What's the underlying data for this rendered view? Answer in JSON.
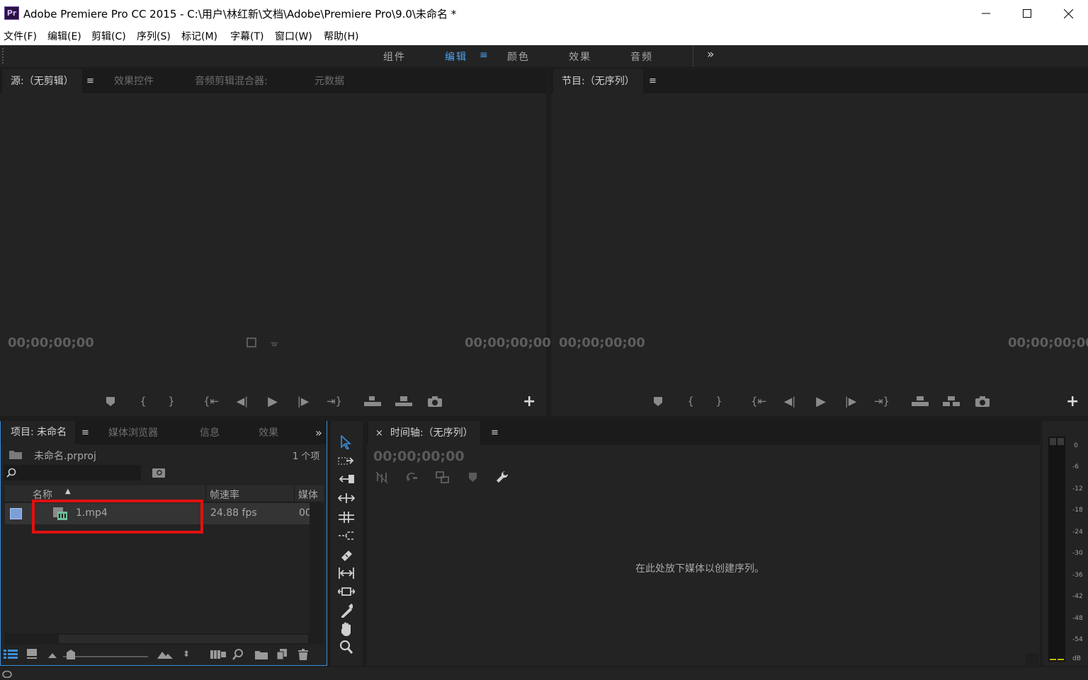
{
  "window": {
    "app_badge": "Pr",
    "title": "Adobe Premiere Pro CC 2015 - C:\\用户\\林红新\\文档\\Adobe\\Premiere Pro\\9.0\\未命名 *"
  },
  "menu": [
    "文件(F)",
    "编辑(E)",
    "剪辑(C)",
    "序列(S)",
    "标记(M)",
    "字幕(T)",
    "窗口(W)",
    "帮助(H)"
  ],
  "workspaces": {
    "tabs": [
      "组件",
      "编辑",
      "颜色",
      "效果",
      "音频"
    ],
    "active": "编辑",
    "overflow": "»"
  },
  "source_panel": {
    "tabs": [
      "源:（无剪辑）",
      "效果控件",
      "音频剪辑混合器:",
      "元数据"
    ],
    "timecode_left": "00;00;00;00",
    "timecode_right": "00;00;00;00"
  },
  "program_panel": {
    "tab": "节目:（无序列）",
    "timecode_left": "00;00;00;00",
    "timecode_right": "00;00;00;00"
  },
  "project_panel": {
    "tabs": [
      "项目: 未命名",
      "媒体浏览器",
      "信息",
      "效果"
    ],
    "project_file": "未命名.prproj",
    "item_count": "1 个项",
    "columns": [
      "名称",
      "帧速率",
      "媒体"
    ],
    "rows": [
      {
        "name": "1.mp4",
        "fps": "24.88 fps",
        "media": "00"
      }
    ],
    "label_color": "#7d9fd9"
  },
  "timeline_panel": {
    "close": "×",
    "tab": "时间轴:（无序列）",
    "timecode": "00;00;00;00",
    "drop_hint": "在此处放下媒体以创建序列。"
  },
  "audio_meter": {
    "labels": [
      "0",
      "-6",
      "-12",
      "-18",
      "-24",
      "-30",
      "-36",
      "-42",
      "-48",
      "-54",
      "dB"
    ]
  },
  "colors": {
    "accent": "#4aa3f0",
    "highlight_box": "#e01010",
    "panel_bg": "#232323"
  }
}
